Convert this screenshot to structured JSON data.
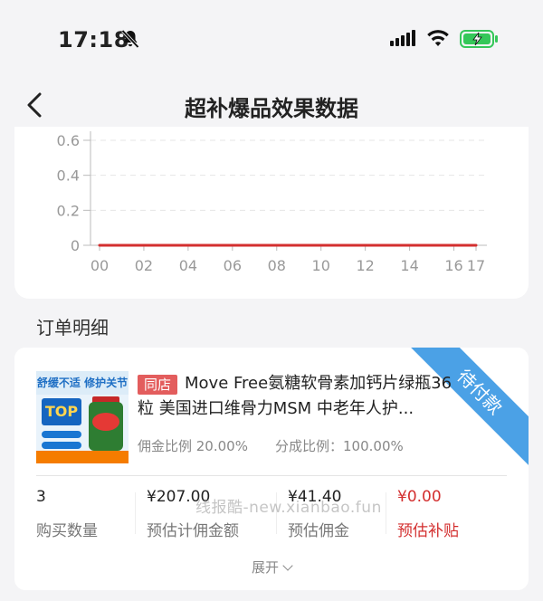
{
  "status_bar": {
    "time": "17:18",
    "icons": [
      "bell-slash-icon",
      "cellular-signal-icon",
      "wifi-icon",
      "battery-charging-icon"
    ],
    "battery_color": "#35c759"
  },
  "nav": {
    "title": "超补爆品效果数据",
    "back_icon": "chevron-left-icon"
  },
  "chart_data": {
    "type": "line",
    "x": [
      "00",
      "02",
      "04",
      "06",
      "08",
      "10",
      "12",
      "14",
      "16",
      "17"
    ],
    "y_ticks": [
      "0",
      "0.2",
      "0.4",
      "0.6"
    ],
    "ylim": [
      0,
      0.6
    ],
    "series": [
      {
        "values": [
          0,
          0,
          0,
          0,
          0,
          0,
          0,
          0,
          0,
          0
        ],
        "color": "#d32f2f"
      }
    ],
    "grid": true
  },
  "section": {
    "title": "订单明细"
  },
  "order": {
    "status_ribbon": "待付款",
    "ribbon_color": "#4ba1e6",
    "thumb_text": "舒缓不适 修护关节",
    "thumb_badge": "TOP",
    "shop_tag": "同店",
    "title": "Move Free氨糖软骨素加钙片绿瓶36粒 美国进口维骨力MSM 中老年人护...",
    "commission_rate": "佣金比例 20.00%",
    "share_rate": "分成比例：100.00%",
    "metrics": [
      {
        "value": "3",
        "label": "购买数量"
      },
      {
        "value": "¥207.00",
        "label": "预估计佣金额"
      },
      {
        "value": "¥41.40",
        "label": "预估佣金"
      },
      {
        "value": "¥0.00",
        "label": "预估补贴"
      }
    ],
    "watermark": "线报酷-new.xianbao.fun",
    "expand_label": "展开",
    "accent_red": "#d32f2f"
  }
}
